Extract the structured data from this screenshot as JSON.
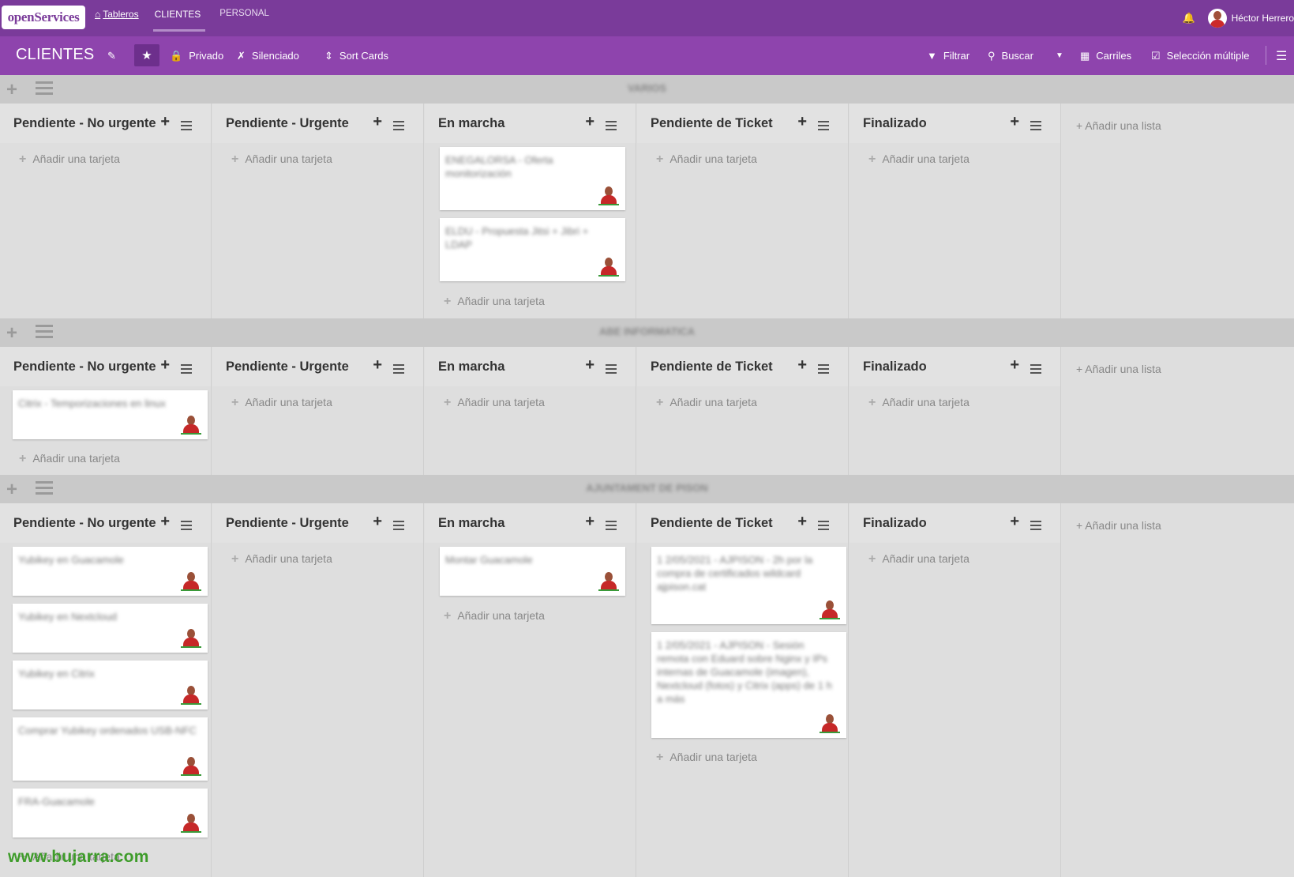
{
  "app": {
    "logo_text": "openServices"
  },
  "top_nav": {
    "home": "Tableros",
    "clientes": "CLIENTES",
    "personal": "PERSONAL",
    "user_name": "Héctor Herrero"
  },
  "board": {
    "title": "CLIENTES",
    "privado": "Privado",
    "silenciado": "Silenciado",
    "sort_cards": "Sort Cards",
    "filtrar": "Filtrar",
    "buscar": "Buscar",
    "carriles": "Carriles",
    "seleccion_multiple": "Selección múltiple"
  },
  "labels": {
    "add_card": "Añadir una tarjeta",
    "add_list": "Añadir una lista"
  },
  "lists": {
    "l0": "Pendiente - No urgente",
    "l1": "Pendiente - Urgente",
    "l2": "En marcha",
    "l3": "Pendiente de Ticket",
    "l4": "Finalizado"
  },
  "lanes": [
    {
      "title": "VARIOS"
    },
    {
      "title": "ABE INFORMATICA"
    },
    {
      "title": "AJUNTAMENT DE PISON"
    }
  ],
  "cards": {
    "lane0_enmarcha_0": "ENEGALORSA - Oferta monitorización",
    "lane0_enmarcha_1": "ELDU - Propuesta Jitsi + Jibri + LDAP",
    "lane1_pend_0": "Citrix - Temporizaciones en linux",
    "lane2_pend_0": "Yubikey en Guacamole",
    "lane2_pend_1": "Yubikey en Nextcloud",
    "lane2_pend_2": "Yubikey en Citrix",
    "lane2_pend_3": "Comprar Yubikey ordenados USB-NFC",
    "lane2_pend_4": "FRA-Guacamole",
    "lane2_enmarcha_0": "Montar Guacamole",
    "lane2_ticket_0": "1 2/05/2021 - AJPISON - 2h por la compra de certificados wildcard ajpison.cat",
    "lane2_ticket_1": "1 2/05/2021 - AJPISON - Sesión remota con Eduard sobre Nginx y IPs internas de Guacamole (imagen), Nextcloud (fotos) y Citrix (apps) de 1 h a más"
  },
  "watermark": "www.bujarra.com"
}
